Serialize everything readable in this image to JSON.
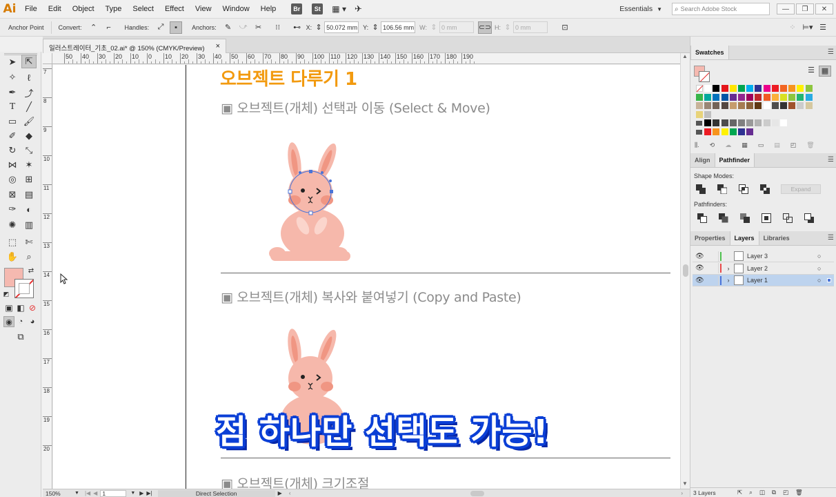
{
  "app": {
    "logo": "Ai",
    "workspace": "Essentials",
    "search_placeholder": "Search Adobe Stock",
    "bridge_label": "Br",
    "stock_label": "St"
  },
  "menu": [
    "File",
    "Edit",
    "Object",
    "Type",
    "Select",
    "Effect",
    "View",
    "Window",
    "Help"
  ],
  "control": {
    "tool_name": "Anchor Point",
    "convert_label": "Convert:",
    "handles_label": "Handles:",
    "anchors_label": "Anchors:",
    "x_label": "X:",
    "x_value": "50.072 mm",
    "y_label": "Y:",
    "y_value": "106.56 mm",
    "w_label": "W:",
    "w_value": "0 mm",
    "h_label": "H:",
    "h_value": "0 mm"
  },
  "document": {
    "tab_title": "일러스트레이터_기초_02.ai* @ 150% (CMYK/Preview)",
    "close": "×"
  },
  "rulers": {
    "h_labels": [
      "50",
      "40",
      "30",
      "20",
      "10",
      "0",
      "10",
      "20",
      "30",
      "40",
      "50",
      "60",
      "70",
      "80",
      "90",
      "100",
      "110",
      "120",
      "130",
      "140",
      "150",
      "160",
      "170",
      "180",
      "190"
    ],
    "v_labels": [
      "7",
      "8",
      "9",
      "10",
      "11",
      "12",
      "13",
      "14",
      "15",
      "16",
      "17",
      "18",
      "19",
      "20"
    ]
  },
  "canvas": {
    "title": "오브젝트 다루기 1",
    "section1": "▣ 오브젝트(개체) 선택과 이동 (Select & Move)",
    "section2": "▣ 오브젝트(개체) 복사와 붙여넣기 (Copy and Paste)",
    "section3": "▣ 오브젝트(개체) 크기조절",
    "caption": "점 하나만 선택도 가능!"
  },
  "colors": {
    "title_orange": "#f29a0f",
    "bunny_pink": "#f6b8ab",
    "bunny_light": "#fbd5cc",
    "bunny_dark": "#f09683",
    "caption_blue": "#0b3fd6",
    "selection_blue": "#4a74d8",
    "fill_swatch": "#f5b9b0"
  },
  "status": {
    "zoom": "150%",
    "artboard": "1",
    "tool": "Direct Selection"
  },
  "panels": {
    "swatches_tab": "Swatches",
    "align_tab": "Align",
    "pathfinder_tab": "Pathfinder",
    "shape_modes_label": "Shape Modes:",
    "expand_label": "Expand",
    "pathfinders_label": "Pathfinders:",
    "properties_tab": "Properties",
    "layers_tab": "Layers",
    "libraries_tab": "Libraries",
    "layers": [
      {
        "name": "Layer 3",
        "color": "#4fc14f"
      },
      {
        "name": "Layer 2",
        "color": "#e84a4a"
      },
      {
        "name": "Layer 1",
        "color": "#4a74d8"
      }
    ],
    "layers_count": "3 Layers"
  }
}
